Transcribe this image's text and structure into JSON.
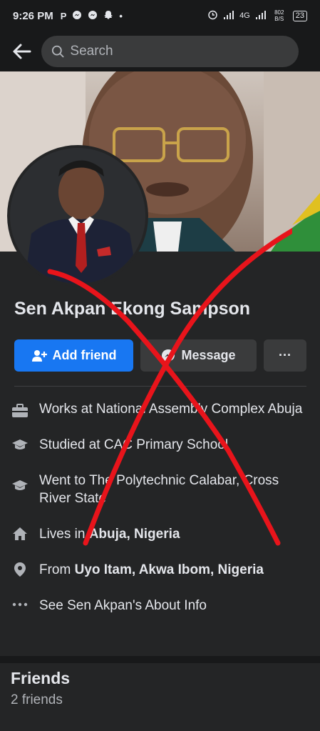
{
  "status_bar": {
    "time": "9:26 PM",
    "left_icons": [
      "P",
      "messenger-icon",
      "messenger-icon",
      "snapchat-icon",
      "•"
    ],
    "right_text": "4G",
    "speed": "802 B/S",
    "battery": "23"
  },
  "search": {
    "placeholder": "Search"
  },
  "profile": {
    "name": "Sen Akpan Ekong Sampson",
    "add_friend_label": "Add friend",
    "message_label": "Message",
    "more_label": "···"
  },
  "details": [
    {
      "icon": "briefcase-icon",
      "prefix": "Works at National Assembly Complex Abuja",
      "bold": ""
    },
    {
      "icon": "graduation-cap-icon",
      "prefix": "Studied at CAC Primary School",
      "bold": ""
    },
    {
      "icon": "graduation-cap-icon",
      "prefix": "Went to The Polytechnic Calabar, Cross River State",
      "bold": ""
    },
    {
      "icon": "home-icon",
      "prefix": "Lives in ",
      "bold": "Abuja, Nigeria"
    },
    {
      "icon": "location-pin-icon",
      "prefix": "From ",
      "bold": "Uyo Itam, Akwa Ibom, Nigeria"
    },
    {
      "icon": "ellipsis-icon",
      "prefix": "See Sen Akpan's About Info",
      "bold": ""
    }
  ],
  "friends": {
    "title": "Friends",
    "count": "2 friends"
  },
  "colors": {
    "accent": "#1877f2",
    "cross": "#e8141b"
  }
}
